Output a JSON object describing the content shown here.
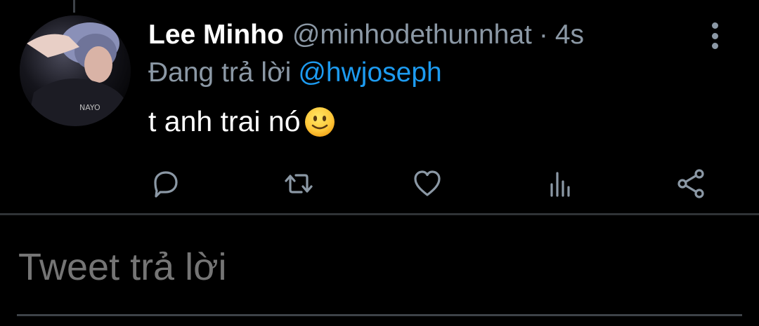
{
  "tweet": {
    "display_name": "Lee Minho",
    "handle": "@minhodethunnhat",
    "separator": "·",
    "time": "4s",
    "reply_prefix": "Đang trả lời",
    "reply_mention": "@hwjoseph",
    "text": "t anh trai nó",
    "emoji": "slightly-smiling-face-icon"
  },
  "actions": [
    {
      "name": "reply",
      "icon": "comment-icon"
    },
    {
      "name": "retweet",
      "icon": "retweet-icon"
    },
    {
      "name": "like",
      "icon": "heart-icon"
    },
    {
      "name": "analytics",
      "icon": "bar-chart-icon"
    },
    {
      "name": "share",
      "icon": "share-icon"
    }
  ],
  "composer": {
    "placeholder": "Tweet trả lời"
  },
  "colors": {
    "background": "#000000",
    "text_primary": "#ffffff",
    "text_secondary": "#8b98a5",
    "accent": "#1d9bf0",
    "divider": "#2f3336"
  }
}
